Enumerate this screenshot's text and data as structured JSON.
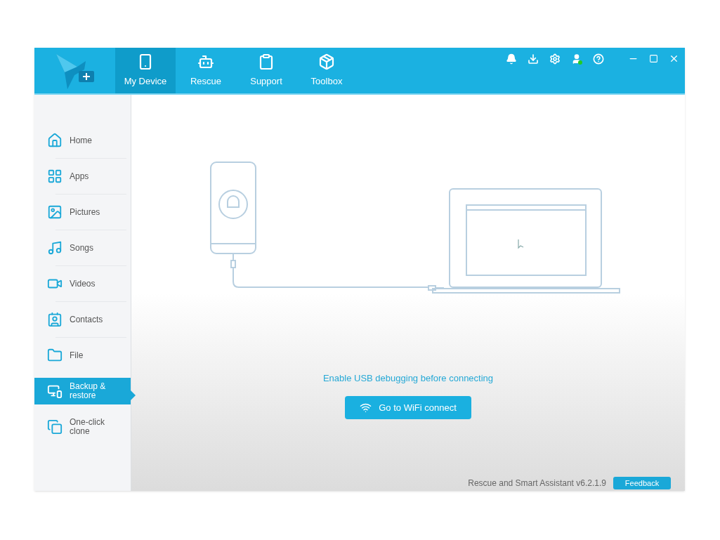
{
  "tabs": [
    {
      "label": "My Device",
      "selected": true
    },
    {
      "label": "Rescue",
      "selected": false
    },
    {
      "label": "Support",
      "selected": false
    },
    {
      "label": "Toolbox",
      "selected": false
    }
  ],
  "user_online": true,
  "sidebar": {
    "items": [
      {
        "label": "Home",
        "selected": false
      },
      {
        "label": "Apps",
        "selected": false
      },
      {
        "label": "Pictures",
        "selected": false
      },
      {
        "label": "Songs",
        "selected": false
      },
      {
        "label": "Videos",
        "selected": false
      },
      {
        "label": "Contacts",
        "selected": false
      },
      {
        "label": "File",
        "selected": false
      },
      {
        "label": "Backup &\nrestore",
        "selected": true
      },
      {
        "label": "One-click\nclone",
        "selected": false
      }
    ]
  },
  "main": {
    "hint": "Enable USB debugging before connecting",
    "wifi_button": "Go to WiFi connect"
  },
  "footer": {
    "version": "Rescue and Smart Assistant v6.2.1.9",
    "feedback_button": "Feedback"
  }
}
